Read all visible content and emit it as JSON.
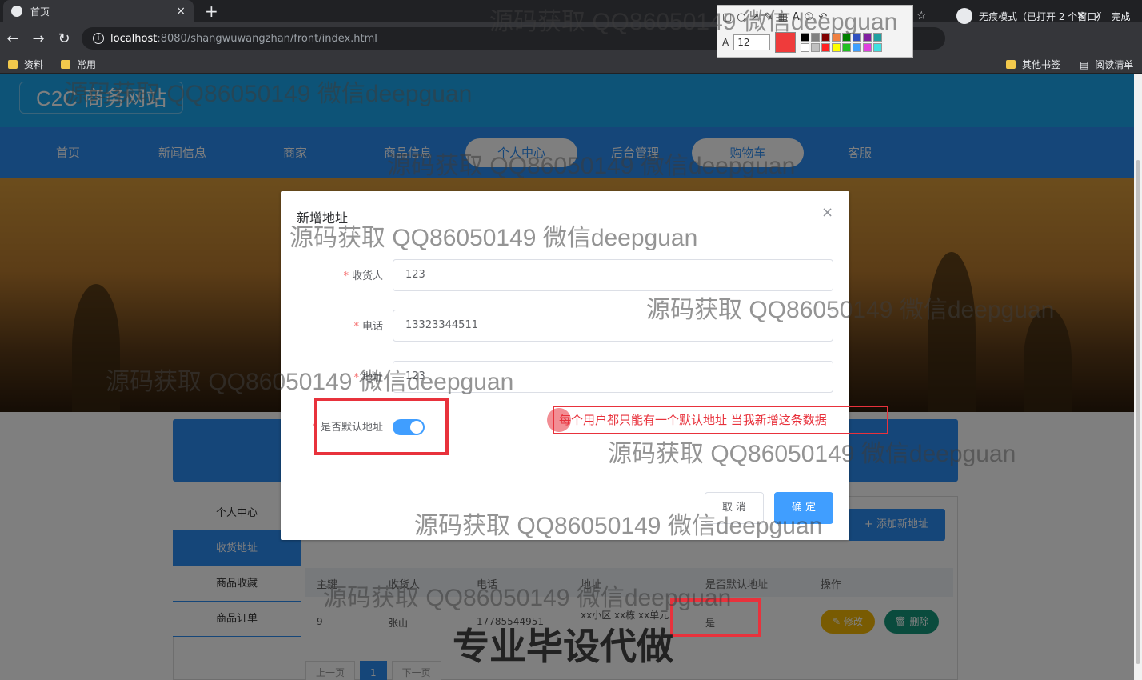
{
  "browser": {
    "tab_title": "首页",
    "tab_close": "×",
    "new_tab": "+",
    "url_host": "localhost",
    "url_path": ":8080/shangwuwangzhan/front/index.html",
    "incognito_label": "无痕模式（已打开 2 个窗口）",
    "bookmarks": [
      "资料",
      "常用"
    ],
    "bookmarks_right": [
      "其他书签",
      "阅读清单"
    ],
    "done_label": "完成"
  },
  "annot_toolbar": {
    "font_size": "12",
    "active_color": "#ef3b3b",
    "palette": [
      "#000000",
      "#808080",
      "#800000",
      "#f08040",
      "#008000",
      "#3050c0",
      "#8020a0",
      "#20a0a0",
      "#ffffff",
      "#c0c0c0",
      "#ff2020",
      "#ffff00",
      "#20c020",
      "#40a0ff",
      "#e040e0",
      "#40e0e0"
    ]
  },
  "site": {
    "logo": "C2C 商务网站",
    "nav": [
      "首页",
      "新闻信息",
      "商家",
      "商品信息",
      "个人中心",
      "后台管理",
      "购物车",
      "客服"
    ]
  },
  "sidebar": [
    "个人中心",
    "收货地址",
    "商品收藏",
    "商品订单"
  ],
  "add_button": "+ 添加新地址",
  "table": {
    "headers": [
      "主键",
      "收货人",
      "电话",
      "地址",
      "是否默认地址",
      "操作"
    ],
    "row": {
      "id": "9",
      "name": "张山",
      "phone": "17785544951",
      "address": "xx小区 xx栋 xx单元",
      "is_default": "是",
      "edit": "修改",
      "delete": "删除"
    }
  },
  "pager": [
    "上一页",
    "1",
    "下一页"
  ],
  "dialog": {
    "title": "新增地址",
    "close": "×",
    "fields": [
      {
        "label": "收货人",
        "value": "123"
      },
      {
        "label": "电话",
        "value": "13323344511"
      },
      {
        "label": "地址",
        "value": "123"
      },
      {
        "label": "是否默认地址",
        "value": ""
      }
    ],
    "switch_on": true,
    "cancel": "取 消",
    "confirm": "确 定"
  },
  "annotation_text": "每个用户都只能有一个默认地址 当我新增这条数据",
  "watermark": "源码获取 QQ86050149 微信deepguan",
  "bottom_watermark": "专业毕设代做"
}
